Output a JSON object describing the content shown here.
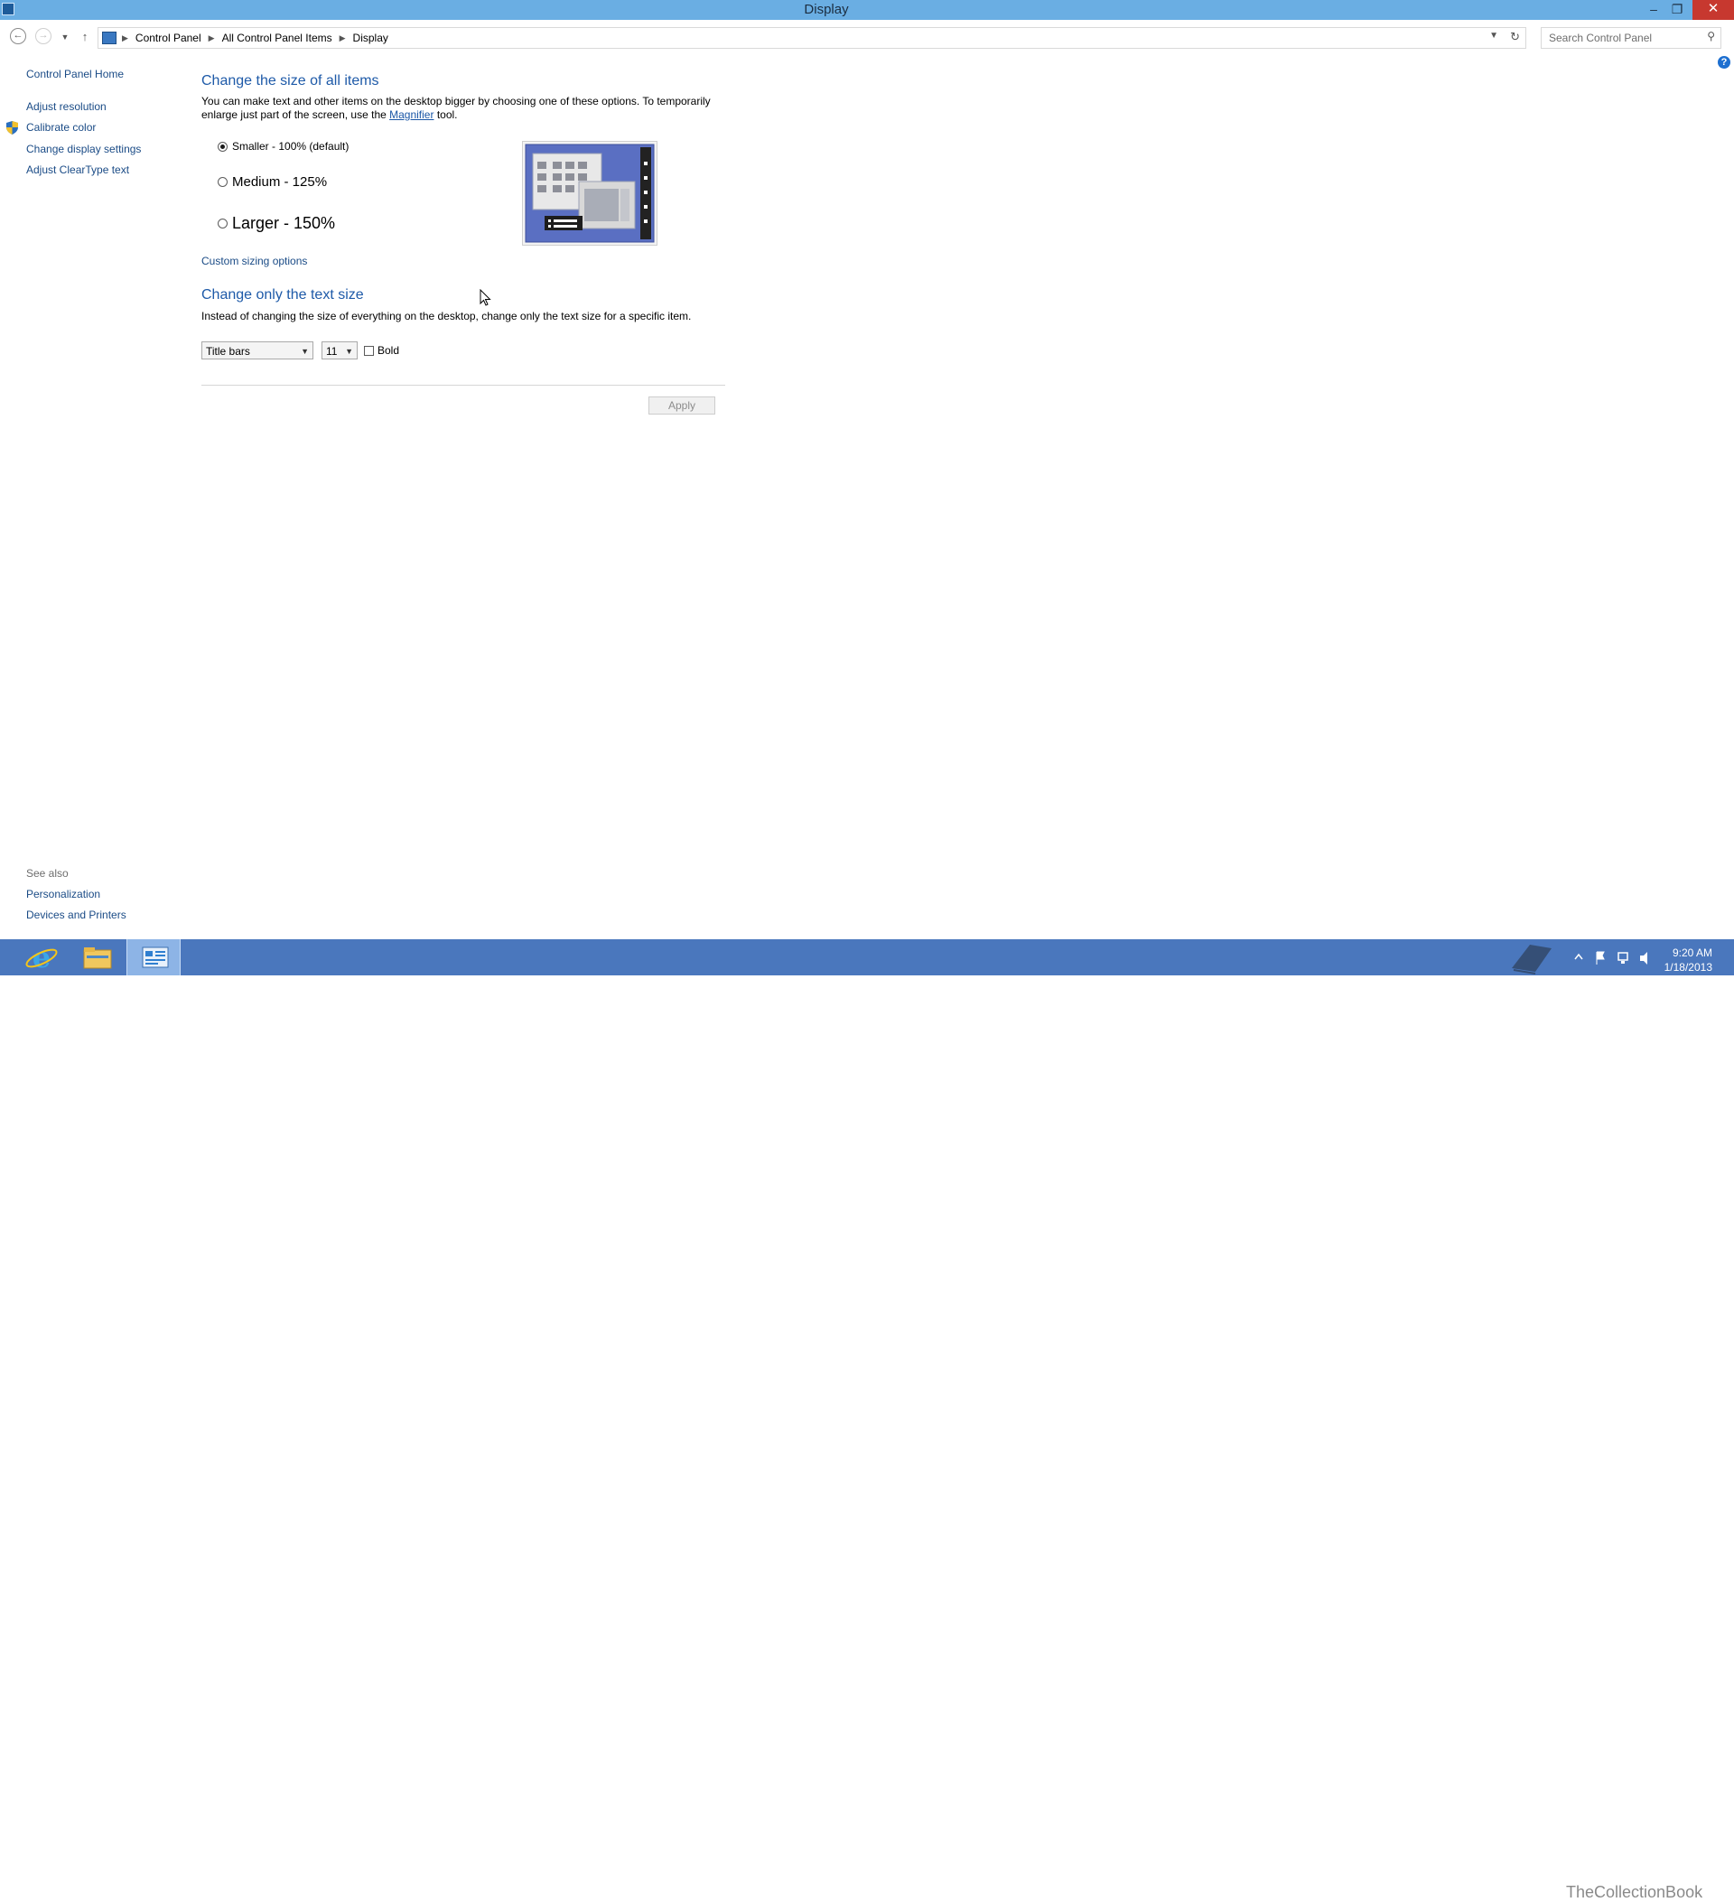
{
  "window": {
    "title": "Display",
    "minimize_glyph": "–",
    "restore_glyph": "❐",
    "close_glyph": "✕"
  },
  "address": {
    "breadcrumbs": [
      "Control Panel",
      "All Control Panel Items",
      "Display"
    ],
    "search_placeholder": "Search Control Panel"
  },
  "sidebar": {
    "home": "Control Panel Home",
    "items": [
      "Adjust resolution",
      "Calibrate color",
      "Change display settings",
      "Adjust ClearType text"
    ],
    "see_also_heading": "See also",
    "see_also": [
      "Personalization",
      "Devices and Printers"
    ]
  },
  "size_section": {
    "heading": "Change the size of all items",
    "description_before": "You can make text and other items on the desktop bigger by choosing one of these options. To temporarily enlarge just part of the screen, use the ",
    "magnifier_link": "Magnifier",
    "description_after": " tool.",
    "options": [
      {
        "label": "Smaller - 100% (default)",
        "checked": true
      },
      {
        "label": "Medium - 125%",
        "checked": false
      },
      {
        "label": "Larger - 150%",
        "checked": false
      }
    ],
    "custom_link": "Custom sizing options"
  },
  "text_section": {
    "heading": "Change only the text size",
    "description": "Instead of changing the size of everything on the desktop, change only the text size for a specific item.",
    "item_select": "Title bars",
    "size_select": "11",
    "bold_label": "Bold",
    "bold_checked": false
  },
  "apply_label": "Apply",
  "taskbar": {
    "time": "9:20 AM",
    "date": "1/18/2013",
    "watermark": "TheCollectionBook"
  },
  "colors": {
    "titlebar": "#6aaee3",
    "link": "#1a4b86",
    "heading": "#1e5aa8",
    "taskbar": "#4a77bd"
  }
}
